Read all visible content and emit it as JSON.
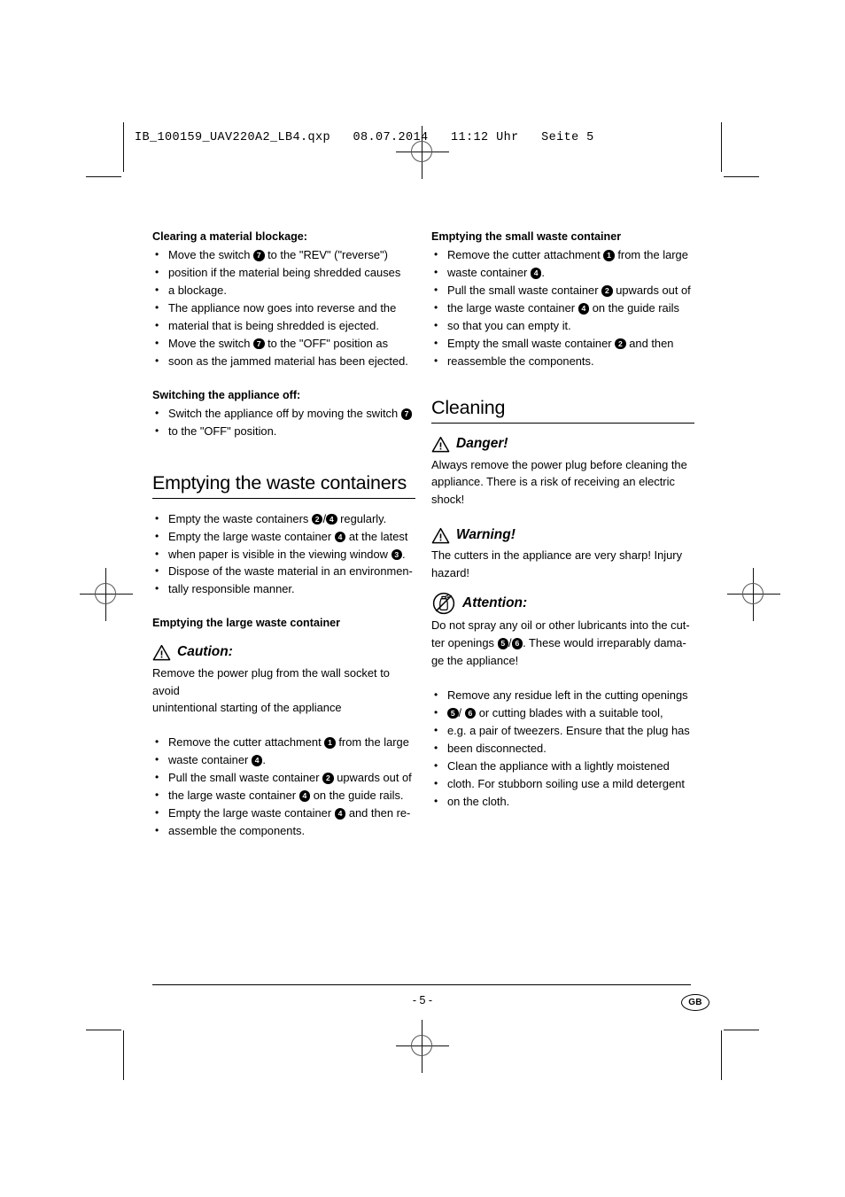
{
  "print_header": {
    "text": "IB_100159_UAV220A2_LB4.qxp   08.07.2014   11:12 Uhr   Seite 5"
  },
  "left_column": {
    "section_blockage": {
      "heading": "Clearing a material blockage:",
      "items": [
        {
          "lines": [
            {
              "parts": [
                {
                  "t": "Move the switch "
                },
                {
                  "badge": "7"
                },
                {
                  "t": " to the \"REV\" (\"reverse\")"
                }
              ]
            },
            {
              "parts": [
                {
                  "t": "position if the material being shredded causes"
                }
              ]
            },
            {
              "parts": [
                {
                  "t": "a blockage."
                }
              ]
            },
            {
              "parts": [
                {
                  "t": "The appliance now goes into reverse and the"
                }
              ]
            },
            {
              "parts": [
                {
                  "t": "material that is being shredded is ejected."
                }
              ]
            }
          ]
        },
        {
          "lines": [
            {
              "parts": [
                {
                  "t": "Move the switch "
                },
                {
                  "badge": "7"
                },
                {
                  "t": " to the \"OFF\" position as"
                }
              ]
            },
            {
              "parts": [
                {
                  "t": "soon as the jammed material has been ejected."
                }
              ]
            }
          ]
        }
      ]
    },
    "section_switch_off": {
      "heading": "Switching the appliance off:",
      "items": [
        {
          "lines": [
            {
              "parts": [
                {
                  "t": "Switch the appliance off by moving the switch "
                },
                {
                  "badge": "7"
                }
              ]
            },
            {
              "parts": [
                {
                  "t": "to the \"OFF\" position."
                }
              ]
            }
          ]
        }
      ]
    },
    "section_emptying": {
      "title": "Emptying the waste containers",
      "items": [
        {
          "lines": [
            {
              "parts": [
                {
                  "t": "Empty the waste containers "
                },
                {
                  "badge": "2"
                },
                {
                  "t": "/"
                },
                {
                  "badge": "4"
                },
                {
                  "t": " regularly."
                }
              ]
            }
          ]
        },
        {
          "lines": [
            {
              "parts": [
                {
                  "t": "Empty the large waste container "
                },
                {
                  "badge": "4"
                },
                {
                  "t": " at the latest"
                }
              ]
            },
            {
              "parts": [
                {
                  "t": "when paper is visible in the viewing window "
                },
                {
                  "badge": "3"
                },
                {
                  "t": "."
                }
              ]
            }
          ]
        },
        {
          "lines": [
            {
              "parts": [
                {
                  "t": "Dispose of the waste material in an environmen-"
                }
              ]
            },
            {
              "parts": [
                {
                  "t": "tally responsible manner."
                }
              ]
            }
          ]
        }
      ]
    },
    "section_large_container": {
      "heading": "Emptying the large waste container",
      "notice": {
        "icon": "warning-triangle-icon",
        "title": "Caution:",
        "lines": [
          "Remove the power plug from the wall socket to avoid",
          "unintentional starting of the appliance"
        ]
      },
      "items": [
        {
          "lines": [
            {
              "parts": [
                {
                  "t": "Remove the cutter attachment "
                },
                {
                  "badge": "1"
                },
                {
                  "t": " from the large"
                }
              ]
            },
            {
              "parts": [
                {
                  "t": "waste container "
                },
                {
                  "badge": "4"
                },
                {
                  "t": "."
                }
              ]
            }
          ]
        },
        {
          "lines": [
            {
              "parts": [
                {
                  "t": "Pull the small waste container "
                },
                {
                  "badge": "2"
                },
                {
                  "t": " upwards out of"
                }
              ]
            },
            {
              "parts": [
                {
                  "t": "the large waste container "
                },
                {
                  "badge": "4"
                },
                {
                  "t": " on the guide rails."
                }
              ]
            }
          ]
        },
        {
          "lines": [
            {
              "parts": [
                {
                  "t": "Empty the large waste container "
                },
                {
                  "badge": "4"
                },
                {
                  "t": " and then re-"
                }
              ]
            },
            {
              "parts": [
                {
                  "t": "assemble the components."
                }
              ]
            }
          ]
        }
      ]
    }
  },
  "right_column": {
    "section_small_container": {
      "heading": "Emptying the small waste container",
      "items": [
        {
          "lines": [
            {
              "parts": [
                {
                  "t": "Remove the cutter attachment "
                },
                {
                  "badge": "1"
                },
                {
                  "t": " from the large"
                }
              ]
            },
            {
              "parts": [
                {
                  "t": "waste container "
                },
                {
                  "badge": "4"
                },
                {
                  "t": "."
                }
              ]
            }
          ]
        },
        {
          "lines": [
            {
              "parts": [
                {
                  "t": "Pull the small waste container "
                },
                {
                  "badge": "2"
                },
                {
                  "t": " upwards out of"
                }
              ]
            },
            {
              "parts": [
                {
                  "t": "the large waste container "
                },
                {
                  "badge": "4"
                },
                {
                  "t": " on the guide rails"
                }
              ]
            },
            {
              "parts": [
                {
                  "t": "so that you can empty it."
                }
              ]
            }
          ]
        },
        {
          "lines": [
            {
              "parts": [
                {
                  "t": "Empty the small waste container "
                },
                {
                  "badge": "2"
                },
                {
                  "t": " and then"
                }
              ]
            },
            {
              "parts": [
                {
                  "t": "reassemble the components."
                }
              ]
            }
          ]
        }
      ]
    },
    "section_cleaning": {
      "title": "Cleaning",
      "notices": [
        {
          "icon": "warning-triangle-icon",
          "title": "Danger!",
          "lines": [
            "Always remove the power plug before cleaning the",
            "appliance. There is a risk of receiving an electric",
            "shock!"
          ]
        },
        {
          "icon": "warning-triangle-icon",
          "title": "Warning!",
          "lines": [
            "The cutters in the appliance are very sharp! Injury",
            "hazard!"
          ]
        }
      ],
      "attention": {
        "icon": "no-spray-icon",
        "title": "Attention:",
        "rich_lines": [
          {
            "parts": [
              {
                "t": "Do not spray any oil or other lubricants into the cut-"
              }
            ]
          },
          {
            "parts": [
              {
                "t": "ter openings "
              },
              {
                "badge": "5"
              },
              {
                "t": "/"
              },
              {
                "badge": "6"
              },
              {
                "t": ". These would irreparably dama-"
              }
            ]
          },
          {
            "parts": [
              {
                "t": "ge the appliance!"
              }
            ]
          }
        ]
      },
      "items": [
        {
          "lines": [
            {
              "parts": [
                {
                  "t": "Remove any residue left in the cutting openings"
                }
              ]
            },
            {
              "parts": [
                {
                  "badge": "5"
                },
                {
                  "t": "/ "
                },
                {
                  "badge": "6"
                },
                {
                  "t": " or cutting blades with a suitable tool,"
                }
              ]
            },
            {
              "parts": [
                {
                  "t": "e.g. a pair of tweezers. Ensure that the plug has"
                }
              ]
            },
            {
              "parts": [
                {
                  "t": "been disconnected."
                }
              ]
            }
          ]
        },
        {
          "lines": [
            {
              "parts": [
                {
                  "t": "Clean the appliance with a lightly moistened"
                }
              ]
            },
            {
              "parts": [
                {
                  "t": "cloth. For stubborn soiling use a mild detergent"
                }
              ]
            },
            {
              "parts": [
                {
                  "t": "on the cloth."
                }
              ]
            }
          ]
        }
      ]
    }
  },
  "footer": {
    "page_number": "- 5 -",
    "language_badge": "GB"
  }
}
